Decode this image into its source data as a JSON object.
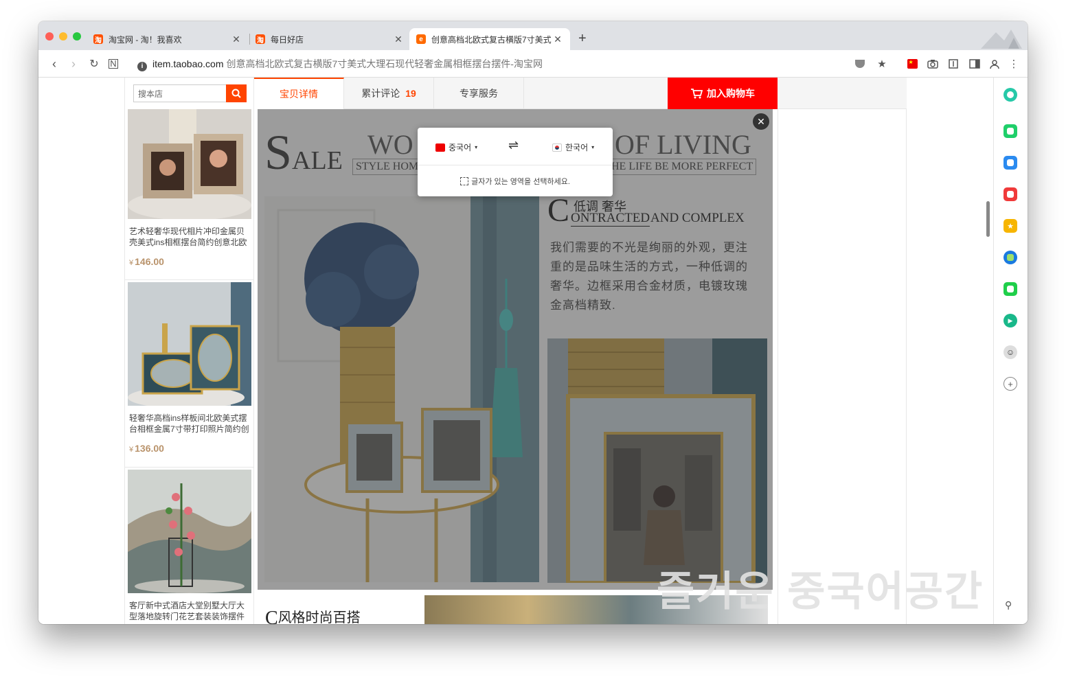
{
  "browser": {
    "tabs": [
      {
        "title": "淘宝网 - 淘！我喜欢",
        "favicon": "taobao-icon"
      },
      {
        "title": "每日好店",
        "favicon": "taobao-icon"
      },
      {
        "title": "创意高档北欧式复古横版7寸美式",
        "favicon": "tmall-icon"
      }
    ],
    "address": {
      "domain": "item.taobao.com",
      "path": "创意高档北欧式复古横版7寸美式大理石现代轻奢金属相框摆台摆件-淘宝网"
    }
  },
  "store": {
    "search_placeholder": "搜本店",
    "products": [
      {
        "name": "艺术轻奢华现代相片冲印金属贝壳美式ins相框摆台简约创意北欧",
        "price": "146.00",
        "currency": "¥"
      },
      {
        "name": "轻奢华高档ins样板间北欧美式摆台相框金属7寸带打印照片简约创",
        "price": "136.00",
        "currency": "¥"
      },
      {
        "name": "客厅新中式酒店大堂别墅大厅大型落地旋转门花艺套装装饰摆件",
        "price": "",
        "currency": ""
      }
    ],
    "tabs": [
      {
        "label": "宝贝详情"
      },
      {
        "label": "累计评论",
        "count": "19"
      },
      {
        "label": "专享服务"
      }
    ],
    "cart_button": "加入购物车"
  },
  "banner": {
    "sale_cap": "S",
    "sale_rest": "ALE",
    "heading_left": "WO",
    "heading_right": "OF LIVING",
    "sub_left": "STYLE HOM",
    "sub_right": "HE LIFE BE MORE PERFECT",
    "section_cn": "低调 奢华",
    "section_cap": "C",
    "section_en_under": "ONTRACTED",
    "section_en_rest": " AND COMPLEX",
    "paragraph": "我们需要的不光是绚丽的外观，更注重的是品味生活的方式，一种低调的奢华。边框采用合金材质，电镀玫瑰金高档精致.",
    "next_section_cap": "C",
    "next_section": "风格时尚百搭"
  },
  "translator": {
    "source_lang": "중국어",
    "target_lang": "한국어",
    "swap": "⇌",
    "hint": "글자가 있는 영역을 선택하세요."
  },
  "watermark": "즐거운 중국어공간",
  "colors": {
    "accent": "#ff4400",
    "cart": "#ff0000",
    "price": "#b9936b"
  }
}
